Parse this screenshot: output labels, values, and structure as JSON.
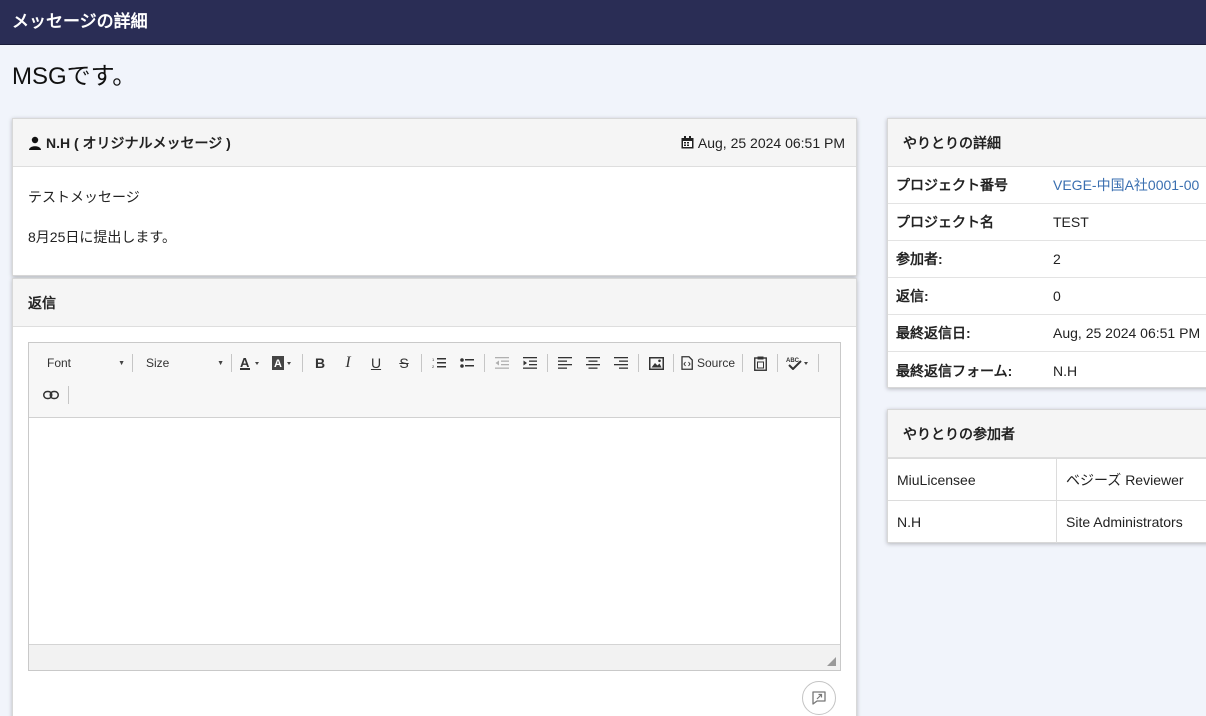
{
  "header": {
    "title": "メッセージの詳細"
  },
  "subject": "MSGです。",
  "message": {
    "author": "N.H ( オリジナルメッセージ )",
    "date": "Aug, 25 2024 06:51 PM",
    "body": [
      "テストメッセージ",
      "8月25日に提出します。"
    ]
  },
  "reply": {
    "title": "返信",
    "toolbar": {
      "font_label": "Font",
      "size_label": "Size",
      "source_label": "Source",
      "icons": [
        "text-color-icon",
        "background-color-icon",
        "bold-icon",
        "italic-icon",
        "underline-icon",
        "strikethrough-icon",
        "numbered-list-icon",
        "bulleted-list-icon",
        "outdent-icon",
        "indent-icon",
        "align-left-icon",
        "align-center-icon",
        "align-right-icon",
        "image-icon",
        "source-icon",
        "paste-icon",
        "spellcheck-icon",
        "link-icon"
      ]
    },
    "send_icon": "send-reply-icon"
  },
  "details": {
    "title": "やりとりの詳細",
    "rows": [
      {
        "label": "プロジェクト番号",
        "value": "VEGE-中国A社0001-00",
        "link": true
      },
      {
        "label": "プロジェクト名",
        "value": "TEST"
      },
      {
        "label": "参加者:",
        "value": "2"
      },
      {
        "label": "返信:",
        "value": "0"
      },
      {
        "label": "最終返信日:",
        "value": "Aug, 25 2024 06:51 PM"
      },
      {
        "label": "最終返信フォーム:",
        "value": "N.H"
      }
    ]
  },
  "participants": {
    "title": "やりとりの参加者",
    "rows": [
      {
        "name": "MiuLicensee",
        "role": "ベジーズ Reviewer"
      },
      {
        "name": "N.H",
        "role": "Site Administrators"
      }
    ]
  },
  "colors": {
    "header_bg": "#2a2d55",
    "page_bg": "#f1f4fb",
    "link": "#3a6fb0"
  }
}
